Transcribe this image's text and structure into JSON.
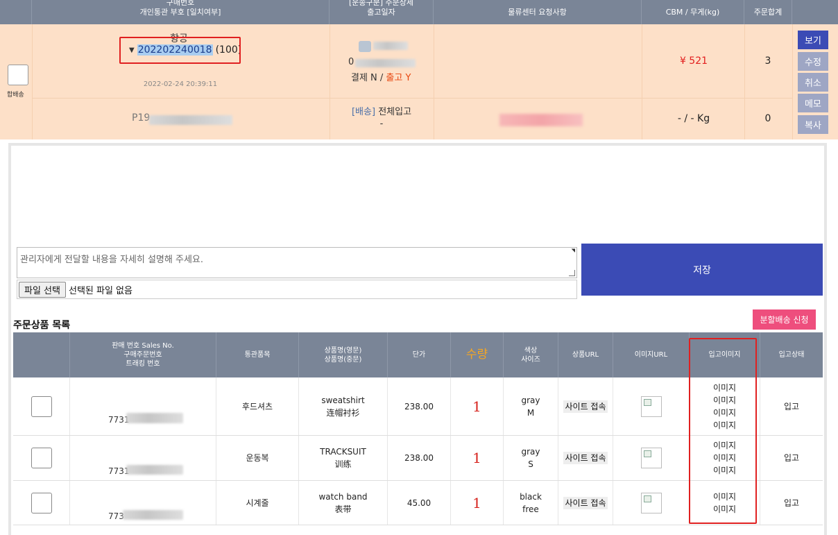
{
  "top_header": {
    "col_order": [
      "구매번호",
      "개인통관 부호 [일치여부]"
    ],
    "col_member": [
      "[운송구분] 주문상세",
      "출고일자"
    ],
    "col_request": "물류센터 요청사항",
    "col_cbm": "CBM / 무게(kg)",
    "col_total": "주문합계"
  },
  "order": {
    "merge_label": "합배송",
    "ship_type": "항공",
    "order_no": "202202240018",
    "order_count": "(100)",
    "order_date": "2022-02-24 20:39:11",
    "customs_prefix": "P19",
    "member_prefix": "0",
    "pay_label": "결제 N / ",
    "release_label": "출고 Y",
    "ship_method": "[배송]",
    "ship_status": "전체입고",
    "ship_dash": "-",
    "price": "¥ 521",
    "qty_total": "3",
    "weight": "- / - Kg",
    "qty_zero": "0",
    "actions": [
      "보기",
      "수정",
      "취소",
      "메모",
      "복사"
    ]
  },
  "memo": {
    "placeholder": "관리자에게 전달할 내용을 자세히 설명해 주세요.",
    "file_button": "파일 선택",
    "file_status": "선택된 파일 없음",
    "save": "저장"
  },
  "products": {
    "title": "주문상품 목록",
    "split_button": "분할배송 신청",
    "headers": {
      "sales": [
        "판매 번호 Sales No.",
        "구매주문번호",
        "트래킹 번호"
      ],
      "category": "통관품목",
      "name": [
        "상품명(영문)",
        "상품명(중문)"
      ],
      "unit_price": "단가",
      "qty": "수량",
      "color_size": [
        "색상",
        "사이즈"
      ],
      "url": "상품URL",
      "image_url": "이미지URL",
      "in_image": "입고이미지",
      "in_status": "입고상태"
    },
    "rows": [
      {
        "sales_no": "7731",
        "category": "후드셔츠",
        "name_en": "sweatshirt",
        "name_cn": "连帽衬衫",
        "unit_price": "238.00",
        "qty": "1",
        "color": "gray",
        "size": "M",
        "site": "사이트 접속",
        "images": [
          "이미지",
          "이미지",
          "이미지",
          "이미지"
        ],
        "status": "입고"
      },
      {
        "sales_no": "7731",
        "category": "운동복",
        "name_en": "TRACKSUIT",
        "name_cn": "训练",
        "unit_price": "238.00",
        "qty": "1",
        "color": "gray",
        "size": "S",
        "site": "사이트 접속",
        "images": [
          "이미지",
          "이미지",
          "이미지"
        ],
        "status": "입고"
      },
      {
        "sales_no": "773",
        "category": "시계줄",
        "name_en": "watch band",
        "name_cn": "表带",
        "unit_price": "45.00",
        "qty": "1",
        "color": "black",
        "size": "free",
        "site": "사이트 접속",
        "images": [
          "이미지",
          "이미지"
        ],
        "status": "입고"
      }
    ]
  },
  "colors": {
    "header_bg": "#7a8597",
    "order_row_bg": "#fde0c8",
    "primary": "#3b4bb5",
    "split_pink": "#ee4e7d",
    "highlight_red": "#e02020"
  },
  "icons": [
    "caret-down-icon",
    "avatar-icon",
    "broken-image-icon",
    "resize-handle-icon"
  ]
}
